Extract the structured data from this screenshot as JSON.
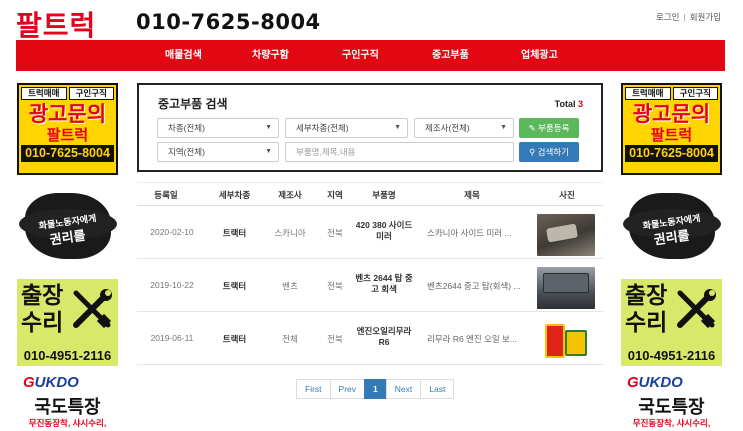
{
  "header": {
    "logo": "팔트럭",
    "phone": "010-7625-8004",
    "login": "로그인",
    "separator": "|",
    "signup": "회원가입"
  },
  "nav": [
    {
      "label": "매물검색"
    },
    {
      "label": "차량구함"
    },
    {
      "label": "구인구직"
    },
    {
      "label": "중고부품"
    },
    {
      "label": "업체광고"
    }
  ],
  "ads": {
    "ad1": {
      "tab1": "트럭매매",
      "tab2": "구인구직",
      "big": "광고문의",
      "mid": "팔트럭",
      "phone": "010-7625-8004"
    },
    "ad2": {
      "line1": "화물노동자에게",
      "line2": "권리를"
    },
    "ad3": {
      "line1": "출장",
      "line2": "수리",
      "phone": "010-4951-2116"
    },
    "ad4": {
      "brand": "UKDO",
      "title": "국도특장",
      "sub": "무진동장착, 샤시수리,"
    }
  },
  "search": {
    "title": "중고부품 검색",
    "total_label": "Total",
    "total_count": "3",
    "vehicle_type": "차종(전체)",
    "sub_vehicle_type": "세부차종(전체)",
    "manufacturer": "제조사(전체)",
    "region": "지역(전체)",
    "keyword_placeholder": "부품명,제목,내용",
    "register_button": "부품등록",
    "search_button": "검색하기"
  },
  "table": {
    "headers": [
      "등록일",
      "세부차종",
      "제조사",
      "지역",
      "부품명",
      "제목",
      "사진"
    ],
    "rows": [
      {
        "date": "2020-02-10",
        "type": "트랙터",
        "maker": "스카니아",
        "region": "전북",
        "part": "420 380 사이드 미러",
        "title": "스카니아 사이드 미러 ..."
      },
      {
        "date": "2019-10-22",
        "type": "트랙터",
        "maker": "벤츠",
        "region": "전북",
        "part": "벤츠 2644 탑 중고 회색",
        "title": "벤츠2644 중고 탑(회색) ..."
      },
      {
        "date": "2019-06-11",
        "type": "트랙터",
        "maker": "전체",
        "region": "전북",
        "part": "엔진오일리무라 R6",
        "title": "리무라 R6 엔진 오일 보..."
      }
    ]
  },
  "pager": {
    "first": "First",
    "prev": "Prev",
    "current": "1",
    "next": "Next",
    "last": "Last"
  },
  "colors": {
    "brand_red": "#e30613",
    "primary_blue": "#337ab7",
    "success_green": "#5cb85c"
  }
}
